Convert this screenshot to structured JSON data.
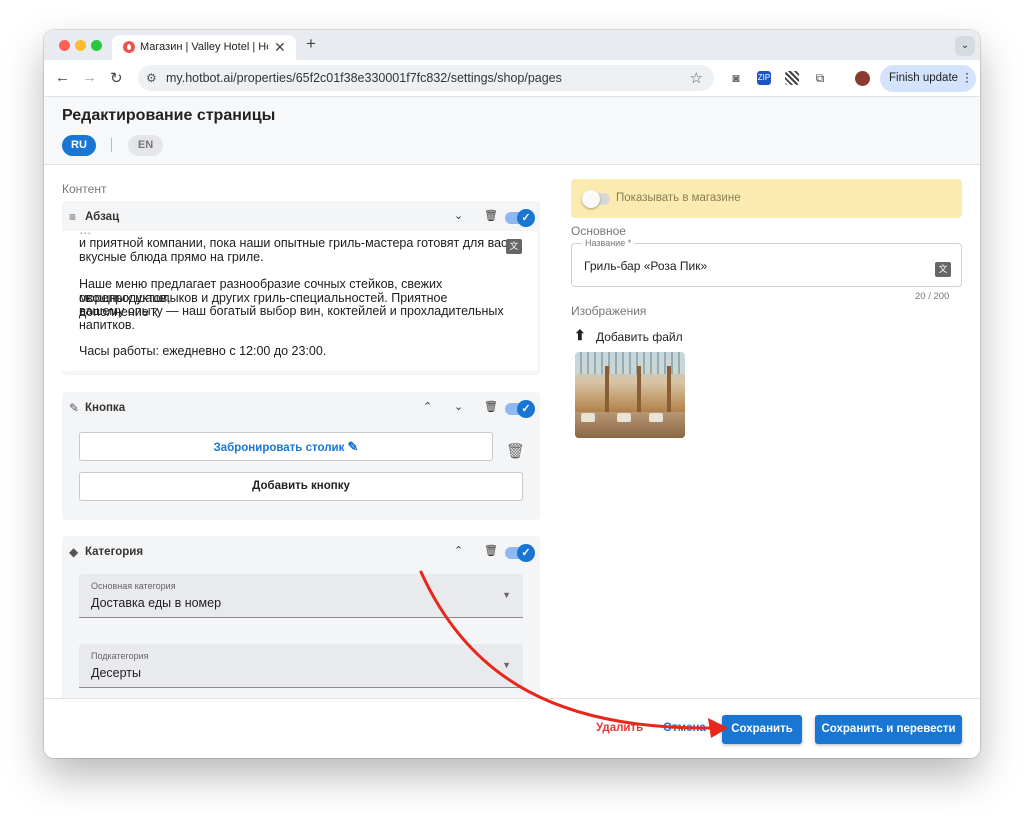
{
  "browser": {
    "tab_title": "Магазин | Valley Hotel | Hotbot",
    "tab_close": "✕",
    "new_tab": "+",
    "tab_menu": "⌄",
    "url": "my.hotbot.ai/properties/65f2c01f38e330001f7fc832/settings/shop/pages",
    "finish_update": "Finish update ⋮",
    "ext_zip": "ZIP"
  },
  "header": {
    "title": "Редактирование страницы",
    "lang_ru": "RU",
    "lang_en": "EN"
  },
  "content": {
    "label": "Контент",
    "paragraph_card": {
      "title": "Абзац",
      "lines": [
        "и приятной компании, пока наши опытные гриль-мастера готовят для вас",
        "вкусные блюда прямо на гриле.",
        "Наше меню предлагает разнообразие сочных стейков, свежих морепродуктов,",
        "овощных шашлыков и других гриль-специальностей. Приятное дополнение к",
        "вашему опыту — наш богатый выбор вин, коктейлей и прохладительных",
        "напитков.",
        "Часы работы: ежедневно с 12:00 до 23:00."
      ]
    },
    "button_card": {
      "title": "Кнопка",
      "button_label": "Забронировать столик",
      "add_button": "Добавить кнопку"
    },
    "category_card": {
      "title": "Категория",
      "main_label": "Основная категория",
      "main_value": "Доставка еды в номер",
      "sub_label": "Подкатегория",
      "sub_value": "Десерты"
    }
  },
  "side": {
    "show_in_shop": "Показывать в магазине",
    "basic_label": "Основное",
    "name_label": "Название *",
    "name_value": "Гриль-бар «Роза Пик»",
    "counter": "20 / 200",
    "images_label": "Изображения",
    "add_file": "Добавить файл"
  },
  "footer": {
    "delete": "Удалить",
    "cancel": "Отмена",
    "save": "Сохранить",
    "save_translate": "Сохранить и перевести"
  },
  "colors": {
    "accent": "#1976d2",
    "danger": "#e53935",
    "annotation_arrow": "#e8271a",
    "banner": "#fcebb0"
  }
}
